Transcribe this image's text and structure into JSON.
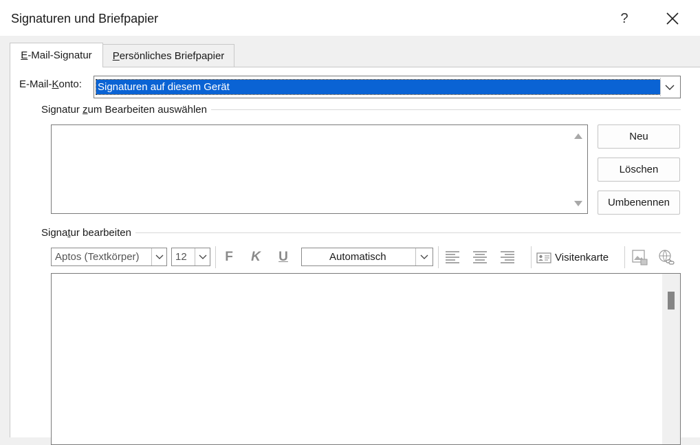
{
  "window": {
    "title": "Signaturen und Briefpapier",
    "help_label": "?"
  },
  "tabs": [
    {
      "label": "E-Mail-Signatur",
      "accel": "E",
      "rest": "-Mail-Signatur",
      "active": true
    },
    {
      "label": "Persönliches Briefpapier",
      "accel": "P",
      "rest": "ersönliches Briefpapier",
      "active": false
    }
  ],
  "account": {
    "label_pre": "E-Mail-",
    "label_accel": "K",
    "label_post": "onto:",
    "selected_value": "Signaturen auf diesem Gerät"
  },
  "select_group": {
    "title_pre": "Signatur ",
    "title_accel": "z",
    "title_post": "um Bearbeiten auswählen",
    "items": []
  },
  "buttons": {
    "new": "Neu",
    "delete": "Löschen",
    "rename": "Umbenennen"
  },
  "edit_group": {
    "title_pre": "Signa",
    "title_accel": "t",
    "title_post": "ur bearbeiten"
  },
  "toolbar": {
    "font": "Aptos (Textkörper)",
    "size": "12",
    "bold": "F",
    "italic": "K",
    "underline": "U",
    "color": "Automatisch",
    "business_card": "Visitenkarte"
  },
  "colors": {
    "selection": "#0a63d4",
    "disabled_icon": "#8a8a8a"
  }
}
